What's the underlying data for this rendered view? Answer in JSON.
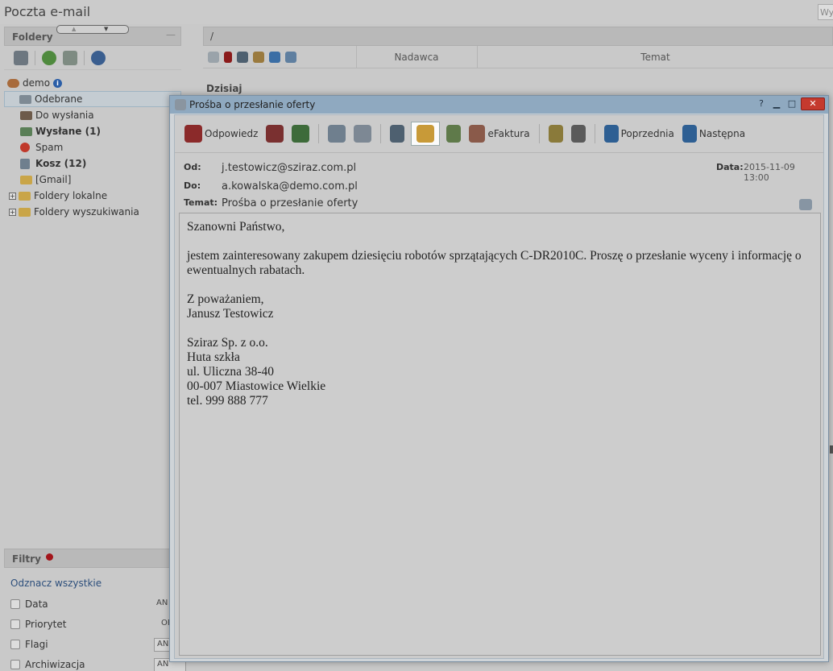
{
  "app": {
    "title": "Poczta e-mail",
    "search_placeholder": "Wy"
  },
  "folders_panel": {
    "title": "Foldery",
    "tools": [
      "tools-icon",
      "globe-icon",
      "database-icon",
      "refresh-icon"
    ],
    "account": "demo",
    "items": [
      {
        "label": "Odebrane",
        "bold": false,
        "icon": "inbox-icon",
        "color": "#7e8a94"
      },
      {
        "label": "Do wysłania",
        "bold": false,
        "icon": "outbox-icon",
        "color": "#6d5a4a"
      },
      {
        "label": "Wysłane (1)",
        "bold": true,
        "icon": "sent-icon",
        "color": "#5a7f57"
      },
      {
        "label": "Spam",
        "bold": false,
        "icon": "spam-icon",
        "color": "#c0392b"
      },
      {
        "label": "Kosz (12)",
        "bold": true,
        "icon": "trash-icon",
        "color": "#6f7f8e"
      },
      {
        "label": "[Gmail]",
        "bold": false,
        "icon": "folder-icon",
        "color": "#c9a548"
      }
    ],
    "groups": [
      {
        "label": "Foldery lokalne"
      },
      {
        "label": "Foldery wyszukiwania"
      }
    ]
  },
  "filters_panel": {
    "title": "Filtry",
    "clear_all": "Odznacz wszystkie",
    "rows": [
      {
        "label": "Data",
        "value": "AN"
      },
      {
        "label": "Priorytet",
        "value": "OF"
      },
      {
        "label": "Flagi",
        "value": "AN"
      },
      {
        "label": "Archiwizacja",
        "value": "AN"
      }
    ]
  },
  "list": {
    "path": "/",
    "col_sender": "Nadawca",
    "col_subject": "Temat",
    "group_today": "Dzisiaj"
  },
  "email_window": {
    "title": "Prośba o przesłanie oferty",
    "toolbar": {
      "reply": "Odpowiedz",
      "efaktura": "eFaktura",
      "previous": "Poprzednia",
      "next": "Następna"
    },
    "from_label": "Od:",
    "from": "j.testowicz@sziraz.com.pl",
    "to_label": "Do:",
    "to": "a.kowalska@demo.com.pl",
    "subject_label": "Temat:",
    "subject": "Prośba o przesłanie oferty",
    "date_label": "Data:",
    "date": "2015-11-09 13:00",
    "body": {
      "greeting": "Szanowni Państwo,",
      "paragraph": "jestem zainteresowany zakupem dziesięciu robotów sprzątających C-DR2010C. Proszę o przesłanie wyceny i informację o ewentualnych rabatach.",
      "closing": "Z poważaniem,\nJanusz Testowicz",
      "signature": "Sziraz Sp. z o.o.\nHuta szkła\nul. Uliczna 38-40\n00-007 Miastowice Wielkie\ntel. 999 888 777"
    }
  },
  "colors": {
    "accent": "#2d4f7c",
    "titlebar": "#8fa9c0",
    "close": "#c53a2e"
  }
}
